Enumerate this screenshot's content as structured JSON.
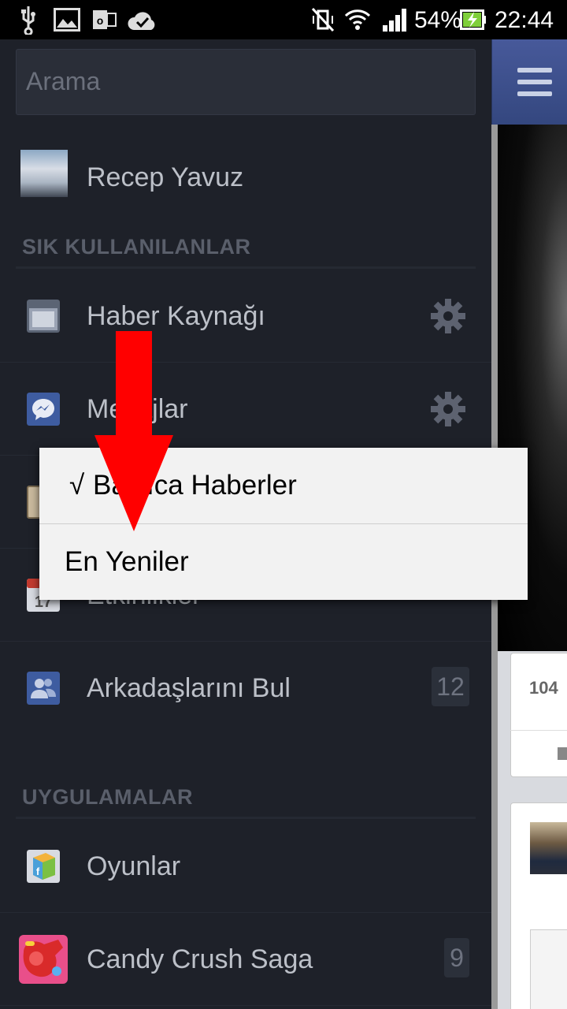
{
  "status_bar": {
    "battery_percent": "54%",
    "time": "22:44",
    "icons": [
      "usb-icon",
      "image-icon",
      "outlook-icon",
      "sync-check-icon",
      "vibrate-off-icon",
      "wifi-icon",
      "signal-icon",
      "battery-charging-icon"
    ]
  },
  "drawer": {
    "search": {
      "placeholder": "Arama"
    },
    "profile": {
      "name": "Recep Yavuz"
    },
    "favorites": {
      "header": "SIK KULLANILANLAR",
      "items": [
        {
          "label": "Haber Kaynağı",
          "icon": "news-feed-icon",
          "has_settings": true
        },
        {
          "label": "Mesajlar",
          "icon": "messages-icon",
          "has_settings": true
        },
        {
          "label": "",
          "icon": "app-icon"
        },
        {
          "label": "Etkinlikler",
          "icon": "calendar-icon",
          "date": "17"
        },
        {
          "label": "Arkadaşlarını Bul",
          "icon": "friends-icon",
          "badge": "12"
        }
      ]
    },
    "apps": {
      "header": "UYGULAMALAR",
      "items": [
        {
          "label": "Oyunlar",
          "icon": "games-icon"
        },
        {
          "label": "Candy Crush Saga",
          "icon": "candy-crush-icon",
          "badge": "9"
        }
      ]
    }
  },
  "popup_menu": {
    "items": [
      {
        "label": "Başlıca Haberler",
        "checked": true,
        "check_mark": "√"
      },
      {
        "label": "En Yeniler",
        "checked": false
      }
    ]
  },
  "feed": {
    "like_count": "104"
  },
  "colors": {
    "drawer_bg": "#1e2129",
    "popup_bg": "#f2f2f2",
    "header_blue": "#3b5998",
    "arrow_red": "#ff0000"
  }
}
